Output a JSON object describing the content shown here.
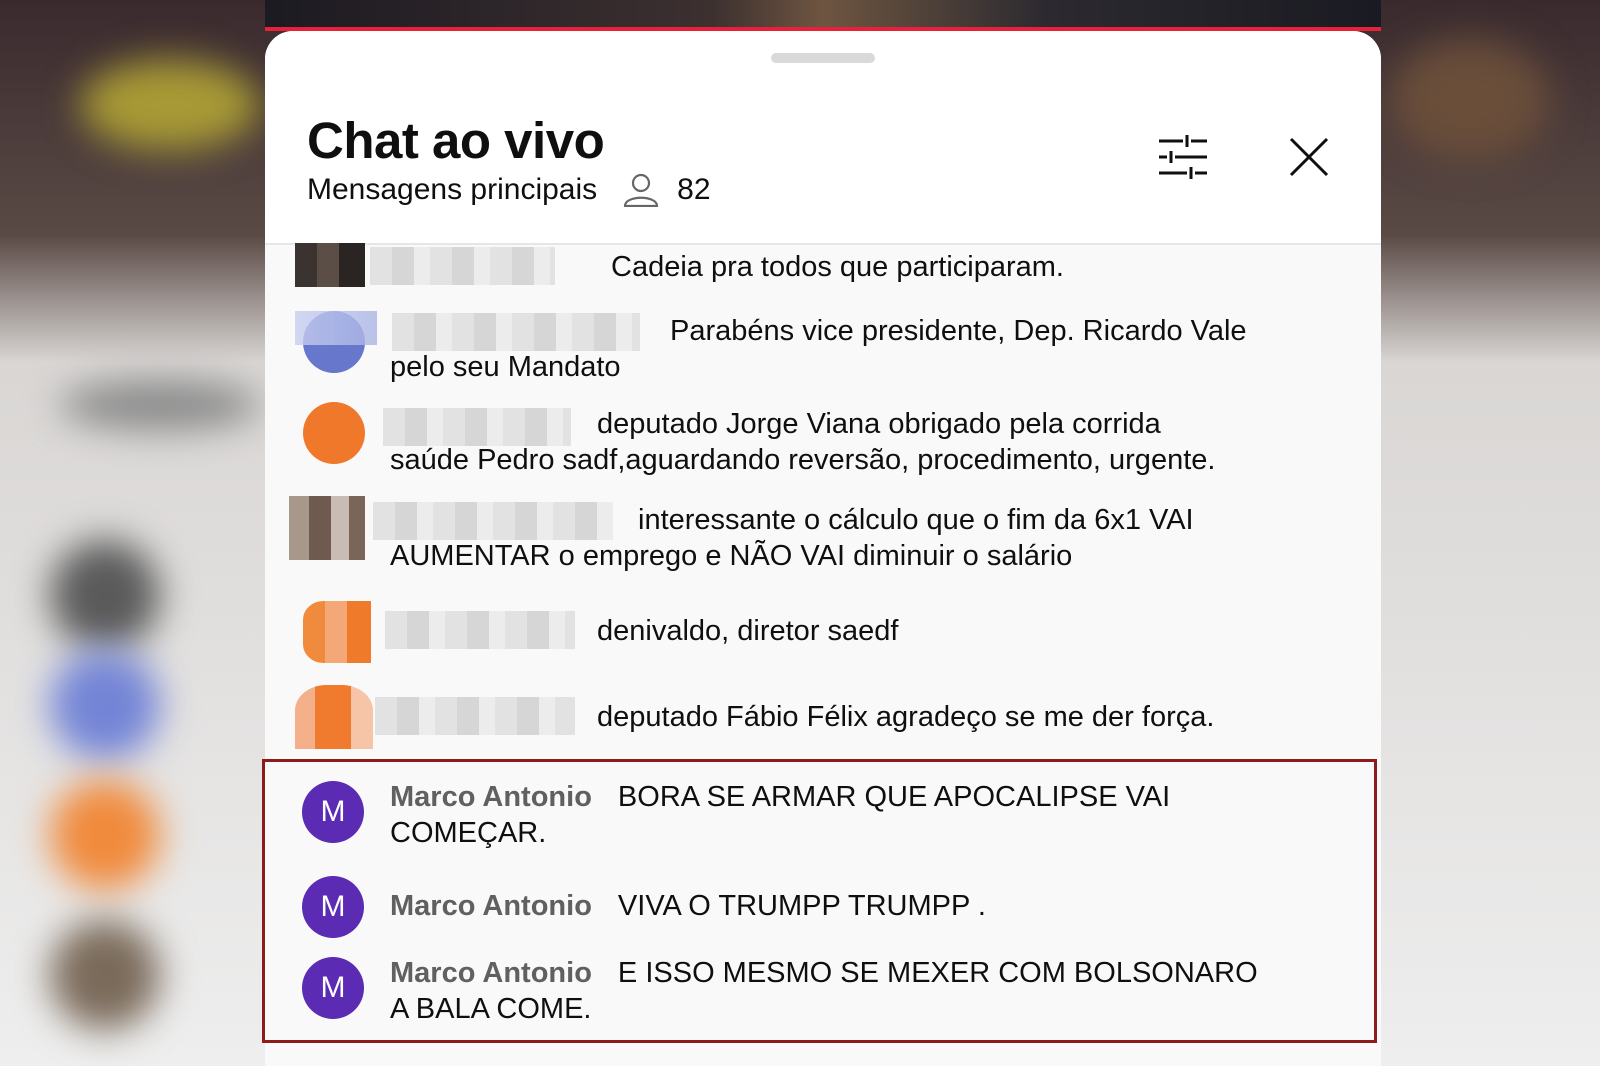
{
  "chat": {
    "title": "Chat ao vivo",
    "mode_label": "Mensagens principais",
    "viewer_count": "82"
  },
  "icons": {
    "viewers": "person-icon",
    "filter": "sliders-icon",
    "close": "close-icon"
  },
  "colors": {
    "accent_red": "#e8213b",
    "avatar_purple": "#5b2bb4",
    "highlight_border": "#8e1b1b"
  },
  "messages": [
    {
      "text": "Cadeia pra todos que participaram."
    },
    {
      "text_line1": "Parabéns vice presidente, Dep. Ricardo Vale",
      "text_line2": "pelo seu Mandato"
    },
    {
      "text_line1": "deputado Jorge Viana obrigado pela corrida",
      "text_line2": "saúde Pedro sadf,aguardando reversão, procedimento, urgente."
    },
    {
      "text_line1": "interessante o cálculo que o fim da 6x1 VAI",
      "text_line2": "AUMENTAR o emprego e NÃO VAI diminuir o salário"
    },
    {
      "text": "denivaldo, diretor saedf"
    },
    {
      "text": "deputado Fábio Félix agradeço se me der força."
    }
  ],
  "highlighted_messages": [
    {
      "avatar_letter": "M",
      "author": "Marco Antonio",
      "text_line1": "BORA SE ARMAR QUE APOCALIPSE VAI",
      "text_line2": "COMEÇAR."
    },
    {
      "avatar_letter": "M",
      "author": "Marco Antonio",
      "text_line1": "VIVA O TRUMPP TRUMPP ."
    },
    {
      "avatar_letter": "M",
      "author": "Marco Antonio",
      "text_line1": "E ISSO MESMO SE MEXER COM BOLSONARO",
      "text_line2": "A BALA COME."
    }
  ]
}
